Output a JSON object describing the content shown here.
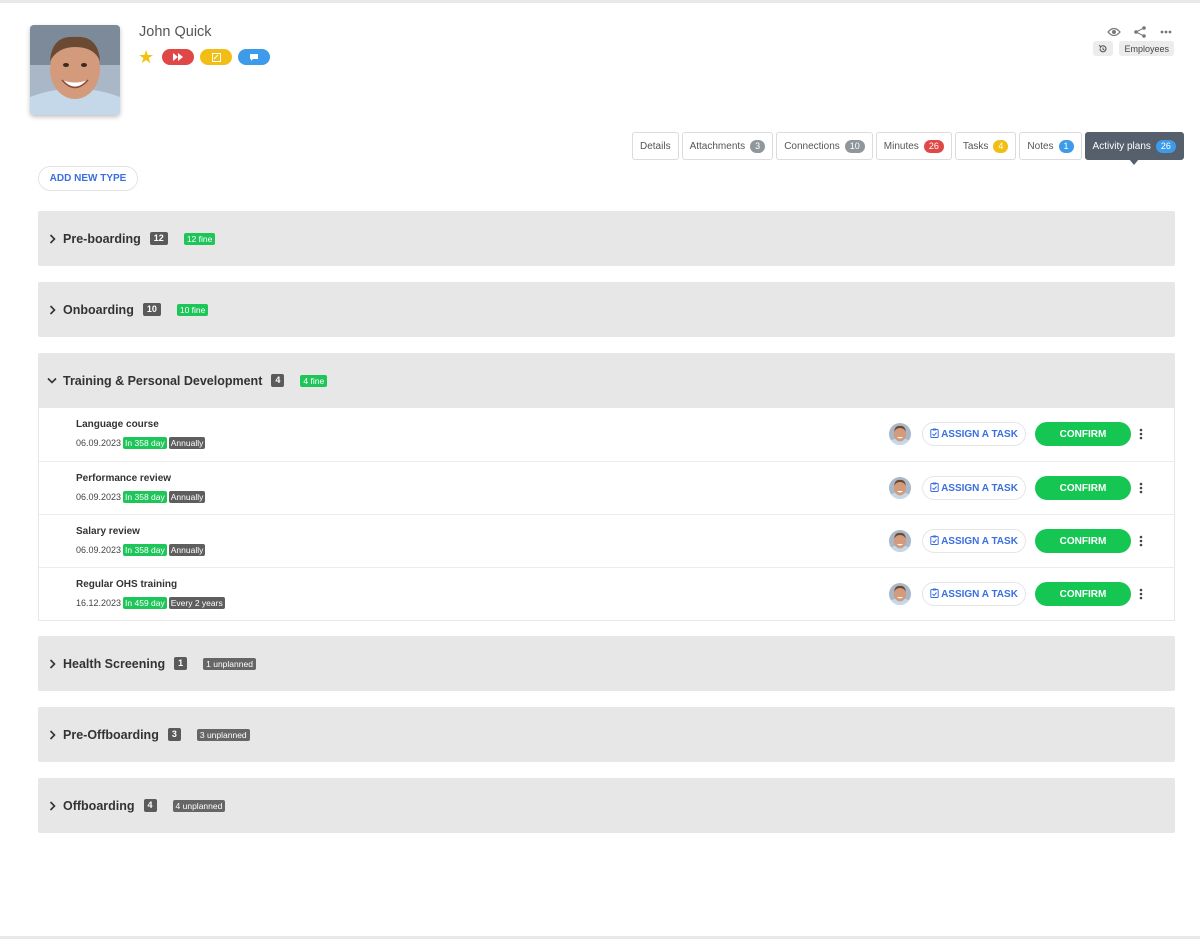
{
  "profile": {
    "name": "John Quick",
    "badges": [
      {
        "name": "star",
        "color": "#f4c20d"
      },
      {
        "name": "forward-icon",
        "color": "#e04848"
      },
      {
        "name": "edit-note-icon",
        "color": "#f2bd14"
      },
      {
        "name": "chat-icon",
        "color": "#3d9be9"
      }
    ]
  },
  "top_actions": {
    "icons": [
      "eye-icon",
      "share-icon",
      "more-horizontal-icon"
    ],
    "history_icon": "history-icon",
    "category_chip": "Employees"
  },
  "tabs": [
    {
      "label": "Details",
      "count": null,
      "color": null,
      "active": false
    },
    {
      "label": "Attachments",
      "count": "3",
      "color": "#8f979d",
      "active": false
    },
    {
      "label": "Connections",
      "count": "10",
      "color": "#8f979d",
      "active": false
    },
    {
      "label": "Minutes",
      "count": "26",
      "color": "#e04848",
      "active": false
    },
    {
      "label": "Tasks",
      "count": "4",
      "color": "#f2bd14",
      "active": false
    },
    {
      "label": "Notes",
      "count": "1",
      "color": "#3d9be9",
      "active": false
    },
    {
      "label": "Activity plans",
      "count": "26",
      "color": "#3d9be9",
      "active": true
    }
  ],
  "add_type_label": "ADD NEW TYPE",
  "sections": [
    {
      "title": "Pre-boarding",
      "count": "12",
      "status": "12 fine",
      "status_type": "ok",
      "expanded": false
    },
    {
      "title": "Onboarding",
      "count": "10",
      "status": "10 fine",
      "status_type": "ok",
      "expanded": false
    },
    {
      "title": "Training & Personal Development",
      "count": "4",
      "status": "4 fine",
      "status_type": "ok",
      "expanded": true,
      "items": [
        {
          "title": "Language course",
          "date": "06.09.2023",
          "due": "In 358 day",
          "recurrence": "Annually"
        },
        {
          "title": "Performance review",
          "date": "06.09.2023",
          "due": "In 358 day",
          "recurrence": "Annually"
        },
        {
          "title": "Salary review",
          "date": "06.09.2023",
          "due": "In 358 day",
          "recurrence": "Annually"
        },
        {
          "title": "Regular OHS training",
          "date": "16.12.2023",
          "due": "In 459 day",
          "recurrence": "Every 2 years"
        }
      ]
    },
    {
      "title": "Health Screening",
      "count": "1",
      "status": "1 unplanned",
      "status_type": "unplanned",
      "expanded": false
    },
    {
      "title": "Pre-Offboarding",
      "count": "3",
      "status": "3 unplanned",
      "status_type": "unplanned",
      "expanded": false
    },
    {
      "title": "Offboarding",
      "count": "4",
      "status": "4 unplanned",
      "status_type": "unplanned",
      "expanded": false
    }
  ],
  "item_actions": {
    "assign_label": "ASSIGN A TASK",
    "confirm_label": "CONFIRM"
  }
}
